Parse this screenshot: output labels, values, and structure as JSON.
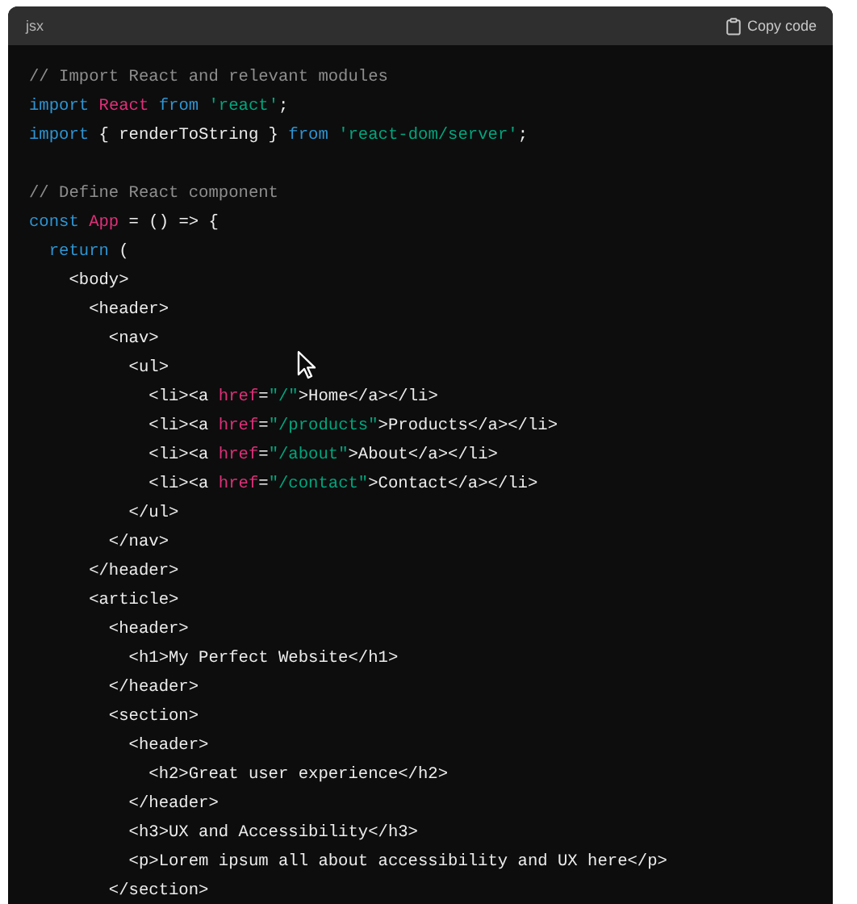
{
  "header": {
    "language": "jsx",
    "copy_button": "Copy code"
  },
  "code_blocks": [
    {
      "lines": [
        [
          {
            "kind": "comment",
            "text": "// Import React and relevant modules"
          }
        ],
        [
          {
            "kind": "keyword",
            "text": "import "
          },
          {
            "kind": "name",
            "text": "React "
          },
          {
            "kind": "keyword",
            "text": "from "
          },
          {
            "kind": "string",
            "text": "'react'"
          },
          {
            "kind": "plain",
            "text": ";"
          }
        ],
        [
          {
            "kind": "keyword",
            "text": "import "
          },
          {
            "kind": "plain",
            "text": "{ renderToString } "
          },
          {
            "kind": "keyword",
            "text": "from "
          },
          {
            "kind": "string",
            "text": "'react-dom/server'"
          },
          {
            "kind": "plain",
            "text": ";"
          }
        ]
      ]
    },
    {
      "lines": [
        [
          {
            "kind": "comment",
            "text": "// Define React component"
          }
        ],
        [
          {
            "kind": "keyword",
            "text": "const "
          },
          {
            "kind": "name",
            "text": "App "
          },
          {
            "kind": "plain",
            "text": "= () => {"
          }
        ],
        [
          {
            "kind": "keyword",
            "text": "  return "
          },
          {
            "kind": "plain",
            "text": "("
          }
        ],
        [
          {
            "kind": "plain",
            "text": "    <body>"
          }
        ],
        [
          {
            "kind": "plain",
            "text": "      <header>"
          }
        ],
        [
          {
            "kind": "plain",
            "text": "        <nav>"
          }
        ],
        [
          {
            "kind": "plain",
            "text": "          <ul>"
          }
        ],
        [
          {
            "kind": "plain",
            "text": "            <li><a "
          },
          {
            "kind": "attr",
            "text": "href"
          },
          {
            "kind": "plain",
            "text": "="
          },
          {
            "kind": "string",
            "text": "\"/\""
          },
          {
            "kind": "plain",
            "text": ">Home</a></li>"
          }
        ],
        [
          {
            "kind": "plain",
            "text": "            <li><a "
          },
          {
            "kind": "attr",
            "text": "href"
          },
          {
            "kind": "plain",
            "text": "="
          },
          {
            "kind": "string",
            "text": "\"/products\""
          },
          {
            "kind": "plain",
            "text": ">Products</a></li>"
          }
        ],
        [
          {
            "kind": "plain",
            "text": "            <li><a "
          },
          {
            "kind": "attr",
            "text": "href"
          },
          {
            "kind": "plain",
            "text": "="
          },
          {
            "kind": "string",
            "text": "\"/about\""
          },
          {
            "kind": "plain",
            "text": ">About</a></li>"
          }
        ],
        [
          {
            "kind": "plain",
            "text": "            <li><a "
          },
          {
            "kind": "attr",
            "text": "href"
          },
          {
            "kind": "plain",
            "text": "="
          },
          {
            "kind": "string",
            "text": "\"/contact\""
          },
          {
            "kind": "plain",
            "text": ">Contact</a></li>"
          }
        ],
        [
          {
            "kind": "plain",
            "text": "          </ul>"
          }
        ],
        [
          {
            "kind": "plain",
            "text": "        </nav>"
          }
        ],
        [
          {
            "kind": "plain",
            "text": "      </header>"
          }
        ],
        [
          {
            "kind": "plain",
            "text": "      <article>"
          }
        ],
        [
          {
            "kind": "plain",
            "text": "        <header>"
          }
        ],
        [
          {
            "kind": "plain",
            "text": "          <h1>My Perfect Website</h1>"
          }
        ],
        [
          {
            "kind": "plain",
            "text": "        </header>"
          }
        ],
        [
          {
            "kind": "plain",
            "text": "        <section>"
          }
        ],
        [
          {
            "kind": "plain",
            "text": "          <header>"
          }
        ],
        [
          {
            "kind": "plain",
            "text": "            <h2>Great user experience</h2>"
          }
        ],
        [
          {
            "kind": "plain",
            "text": "          </header>"
          }
        ],
        [
          {
            "kind": "plain",
            "text": "          <h3>UX and Accessibility</h3>"
          }
        ],
        [
          {
            "kind": "plain",
            "text": "          <p>Lorem ipsum all about accessibility and UX here</p>"
          }
        ],
        [
          {
            "kind": "plain",
            "text": "        </section>"
          }
        ]
      ]
    }
  ]
}
